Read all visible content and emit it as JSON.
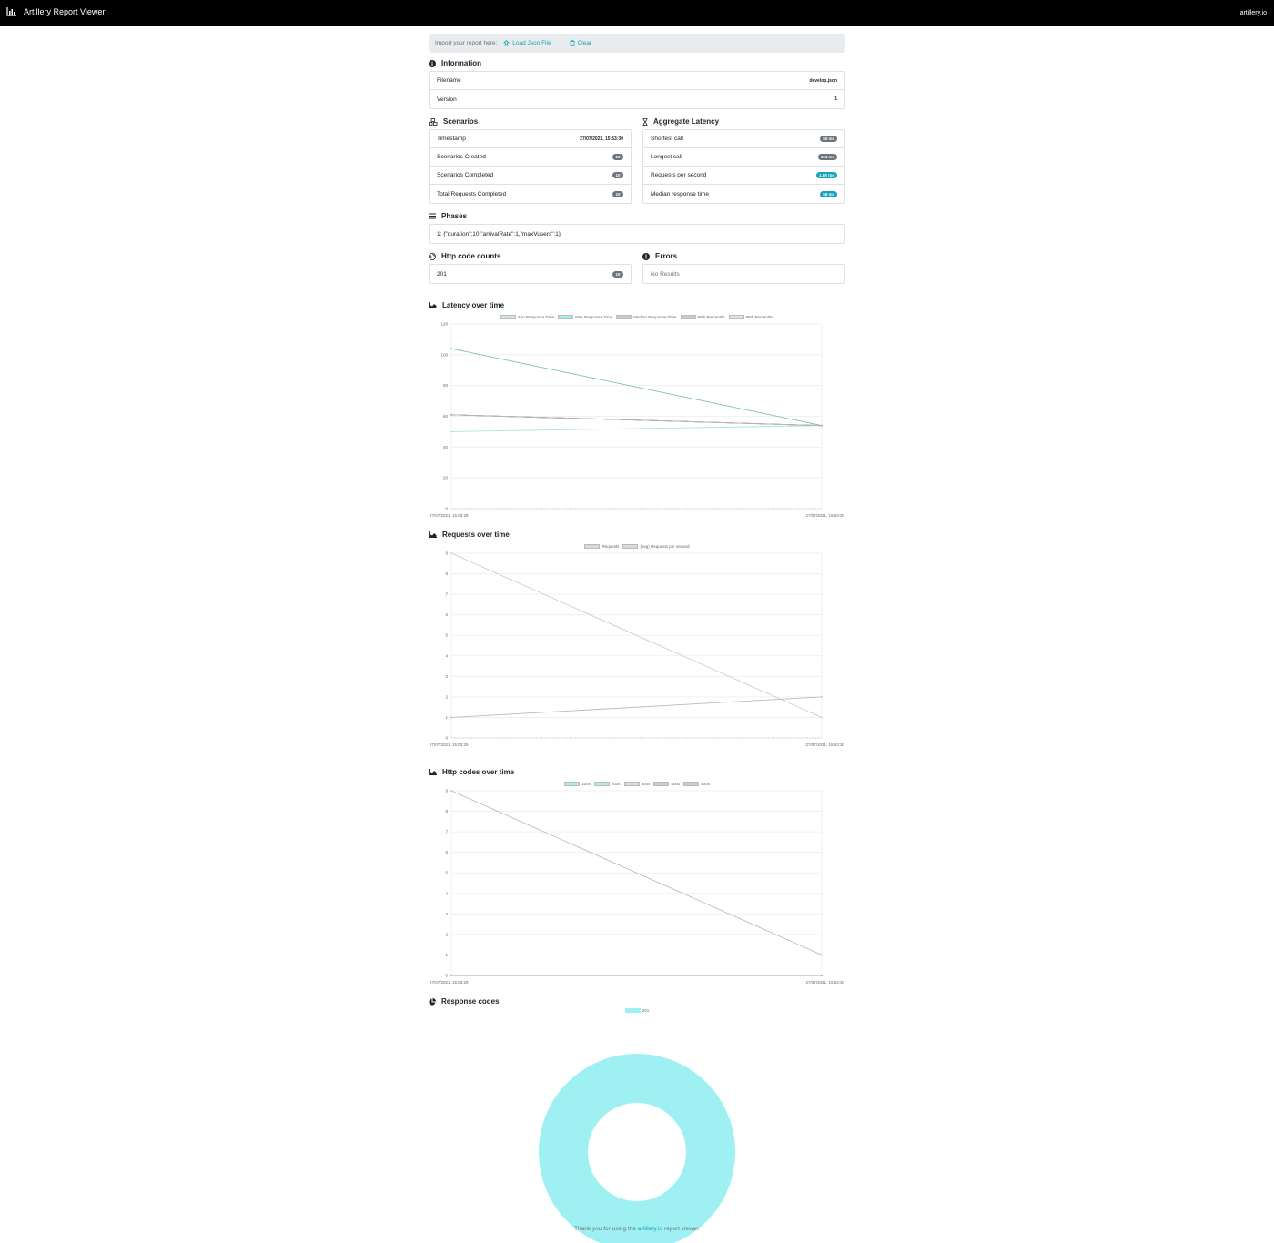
{
  "navbar": {
    "brand": "Artillery Report Viewer",
    "right_link": "artillery.io"
  },
  "import": {
    "label": "Import your report here:",
    "load_label": "Load Json File",
    "clear_label": "Clear"
  },
  "information": {
    "title": "Information",
    "rows": [
      {
        "label": "Filename",
        "value": "develop.json"
      },
      {
        "label": "Version",
        "value": "1"
      }
    ]
  },
  "scenarios": {
    "title": "Scenarios",
    "rows": [
      {
        "label": "Timestamp",
        "value": "27/07/2021, 15:53:30"
      },
      {
        "label": "Scenarios Created",
        "value": "10"
      },
      {
        "label": "Scenarios Completed",
        "value": "10"
      },
      {
        "label": "Total Requests Completed",
        "value": "10"
      }
    ]
  },
  "latency": {
    "title": "Aggregate Latency",
    "rows": [
      {
        "label": "Shortest call",
        "value": "50 ms"
      },
      {
        "label": "Longest call",
        "value": "104 ms"
      },
      {
        "label": "Requests per second",
        "value": "1.88 rps"
      },
      {
        "label": "Median response time",
        "value": "58 ms"
      }
    ]
  },
  "phases": {
    "title": "Phases",
    "text": "1: {\"duration\":10,\"arrivalRate\":1,\"maxVusers\":1}"
  },
  "http_codes": {
    "title": "Http code counts",
    "rows": [
      {
        "label": "201",
        "value": "10"
      }
    ]
  },
  "errors": {
    "title": "Errors",
    "empty_text": "No Results"
  },
  "charts_titles": {
    "latency": "Latency over time",
    "requests": "Requests over time",
    "codes": "Http codes over time",
    "response": "Response codes"
  },
  "colors": {
    "cyan": "#9ff0f2",
    "teal": "#17a2b8",
    "accent_line": "#7fbfa8",
    "dark_line": "#444444",
    "grid": "#eeeeee"
  },
  "chart_data": [
    {
      "type": "line",
      "title": "Latency over time",
      "x": [
        "27/07/2021, 15:53:29",
        "27/07/2021, 15:53:30"
      ],
      "ylim": [
        0,
        120
      ],
      "yticks": [
        0,
        20,
        40,
        60,
        80,
        100,
        120
      ],
      "series": [
        {
          "name": "Min Response Time",
          "values": [
            50,
            54
          ],
          "color": "#a7e6e0"
        },
        {
          "name": "Max Response Time",
          "values": [
            104,
            54
          ],
          "color": "#7fbfa8"
        },
        {
          "name": "Median Response Time",
          "values": [
            61,
            54
          ],
          "color": "#444444"
        },
        {
          "name": "95th Percentile",
          "values": [
            61,
            54
          ],
          "color": "#999999"
        },
        {
          "name": "99th Percentile",
          "values": [
            61,
            54
          ],
          "color": "#bbbbbb"
        }
      ],
      "legend_swatches": [
        "#cfe5e0",
        "#9ff0f2",
        "#cccccc",
        "#cccccc",
        "#dfe6df"
      ],
      "grid": true
    },
    {
      "type": "line",
      "title": "Requests over time",
      "x": [
        "27/07/2021, 15:53:29",
        "27/07/2021, 15:53:30"
      ],
      "ylim": [
        0,
        9
      ],
      "yticks": [
        0,
        1,
        2,
        3,
        4,
        5,
        6,
        7,
        8,
        9
      ],
      "series": [
        {
          "name": "Requests",
          "values": [
            9,
            1
          ],
          "color": "#cccccc"
        },
        {
          "name": "(avg) Requests per second",
          "values": [
            1,
            2
          ],
          "color": "#bbbbbb"
        }
      ],
      "legend_swatches": [
        "#d7ddd7",
        "#d7ddd7"
      ],
      "grid": true
    },
    {
      "type": "line",
      "title": "Http codes over time",
      "x": [
        "27/07/2021, 15:53:29",
        "27/07/2021, 15:53:30"
      ],
      "ylim": [
        0,
        9
      ],
      "yticks": [
        0,
        1,
        2,
        3,
        4,
        5,
        6,
        7,
        8,
        9
      ],
      "series": [
        {
          "name": "100s",
          "values": [
            0,
            0
          ],
          "color": "#9ff0f2"
        },
        {
          "name": "200s",
          "values": [
            9,
            1
          ],
          "color": "#bbbbbb"
        },
        {
          "name": "300s",
          "values": [
            0,
            0
          ],
          "color": "#cccccc"
        },
        {
          "name": "400s",
          "values": [
            0,
            0
          ],
          "color": "#aaaaaa"
        },
        {
          "name": "500s",
          "values": [
            0,
            0
          ],
          "color": "#aaaaaa"
        }
      ],
      "legend_swatches": [
        "#9ff0f2",
        "#b8e6f0",
        "#d7ddd7",
        "#cccccc",
        "#cccccc"
      ],
      "grid": true
    },
    {
      "type": "pie",
      "title": "Response codes",
      "categories": [
        "201"
      ],
      "values": [
        10
      ],
      "color": "#9ff0f2"
    }
  ],
  "footer": {
    "before": "Thank you for using the ",
    "link": "artillery.io",
    "after": " report viewer."
  }
}
